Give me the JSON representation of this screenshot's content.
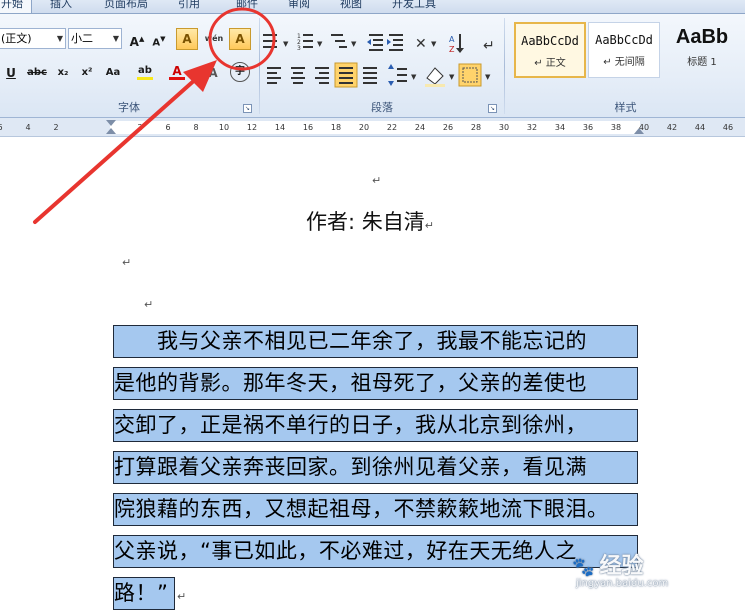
{
  "ribbon_tabs": [
    "开始",
    "插入",
    "页面布局",
    "引用",
    "邮件",
    "审阅",
    "视图",
    "开发工具"
  ],
  "font_group": {
    "label": "字体",
    "font_name": "(正文)",
    "font_size": "小二",
    "buttons": {
      "grow": "A",
      "shrink": "A",
      "clear_format": "A",
      "phonetic": "wén",
      "char_border": "A",
      "underline": "U",
      "strikethrough": "abc",
      "subscript": "x₂",
      "superscript": "x²",
      "change_case": "Aa",
      "highlight": "ab",
      "font_color": "A",
      "char_shading": "A",
      "enclose": "字"
    }
  },
  "paragraph_group": {
    "label": "段落"
  },
  "styles_group": {
    "label": "样式",
    "styles": [
      {
        "sample": "AaBbCcDd",
        "name": "↵ 正文"
      },
      {
        "sample": "AaBbCcDd",
        "name": "↵ 无间隔"
      },
      {
        "sample": "AaBb",
        "name": "标题 1"
      }
    ]
  },
  "ruler": {
    "ticks": [
      "6",
      "4",
      "2",
      "2",
      "6",
      "8",
      "10",
      "12",
      "14",
      "16",
      "18",
      "20",
      "22",
      "24",
      "26",
      "28",
      "30",
      "32",
      "34",
      "36",
      "38",
      "40",
      "42",
      "44",
      "46"
    ]
  },
  "document": {
    "author_line": "作者: 朱自清",
    "paragraph_lines": [
      "　　我与父亲不相见已二年余了，我最不能忘记的",
      "是他的背影。那年冬天，祖母死了，父亲的差使也",
      "交卸了，正是祸不单行的日子，我从北京到徐州，",
      "打算跟着父亲奔丧回家。到徐州见着父亲，看见满",
      "院狼藉的东西，又想起祖母，不禁簌簌地流下眼泪。",
      "父亲说，“事已如此，不必难过，好在天无绝人之",
      "路！”"
    ],
    "return_mark": "↵"
  },
  "watermark": {
    "big": "经验",
    "small": "jingyan.baidu.com"
  },
  "colors": {
    "annotation": "#e8352f",
    "selection": "#a5c8ef",
    "accent": "#e7b64a"
  }
}
